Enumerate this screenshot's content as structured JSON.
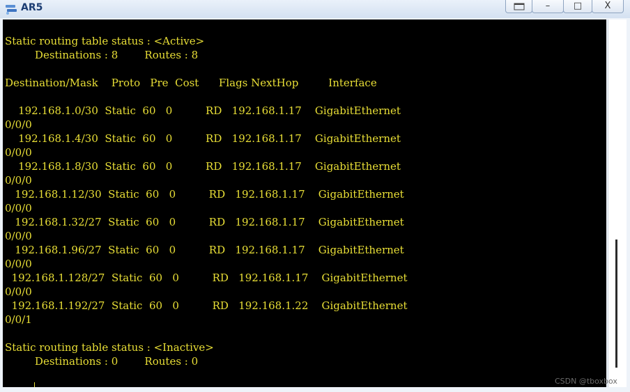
{
  "window": {
    "title": "AR5",
    "icon": "router-app-icon",
    "buttons": {
      "restore": "",
      "minimize": "–",
      "maximize": "□",
      "close": "X"
    }
  },
  "terminal": {
    "text": "Static routing table status : <Active>\n         Destinations : 8        Routes : 8\n\nDestination/Mask    Proto   Pre  Cost      Flags NextHop         Interface\n\n    192.168.1.0/30  Static  60   0          RD   192.168.1.17    GigabitEthernet\n0/0/0\n    192.168.1.4/30  Static  60   0          RD   192.168.1.17    GigabitEthernet\n0/0/0\n    192.168.1.8/30  Static  60   0          RD   192.168.1.17    GigabitEthernet\n0/0/0\n   192.168.1.12/30  Static  60   0          RD   192.168.1.17    GigabitEthernet\n0/0/0\n   192.168.1.32/27  Static  60   0          RD   192.168.1.17    GigabitEthernet\n0/0/0\n   192.168.1.96/27  Static  60   0          RD   192.168.1.17    GigabitEthernet\n0/0/0\n  192.168.1.128/27  Static  60   0          RD   192.168.1.17    GigabitEthernet\n0/0/0\n  192.168.1.192/27  Static  60   0          RD   192.168.1.22    GigabitEthernet\n0/0/1\n\nStatic routing table status : <Inactive>\n         Destinations : 0        Routes : 0"
  },
  "watermark": "CSDN @tboxbox",
  "colors": {
    "terminal_bg": "#000000",
    "terminal_fg": "#e9df36",
    "title": "#1c3d73"
  }
}
